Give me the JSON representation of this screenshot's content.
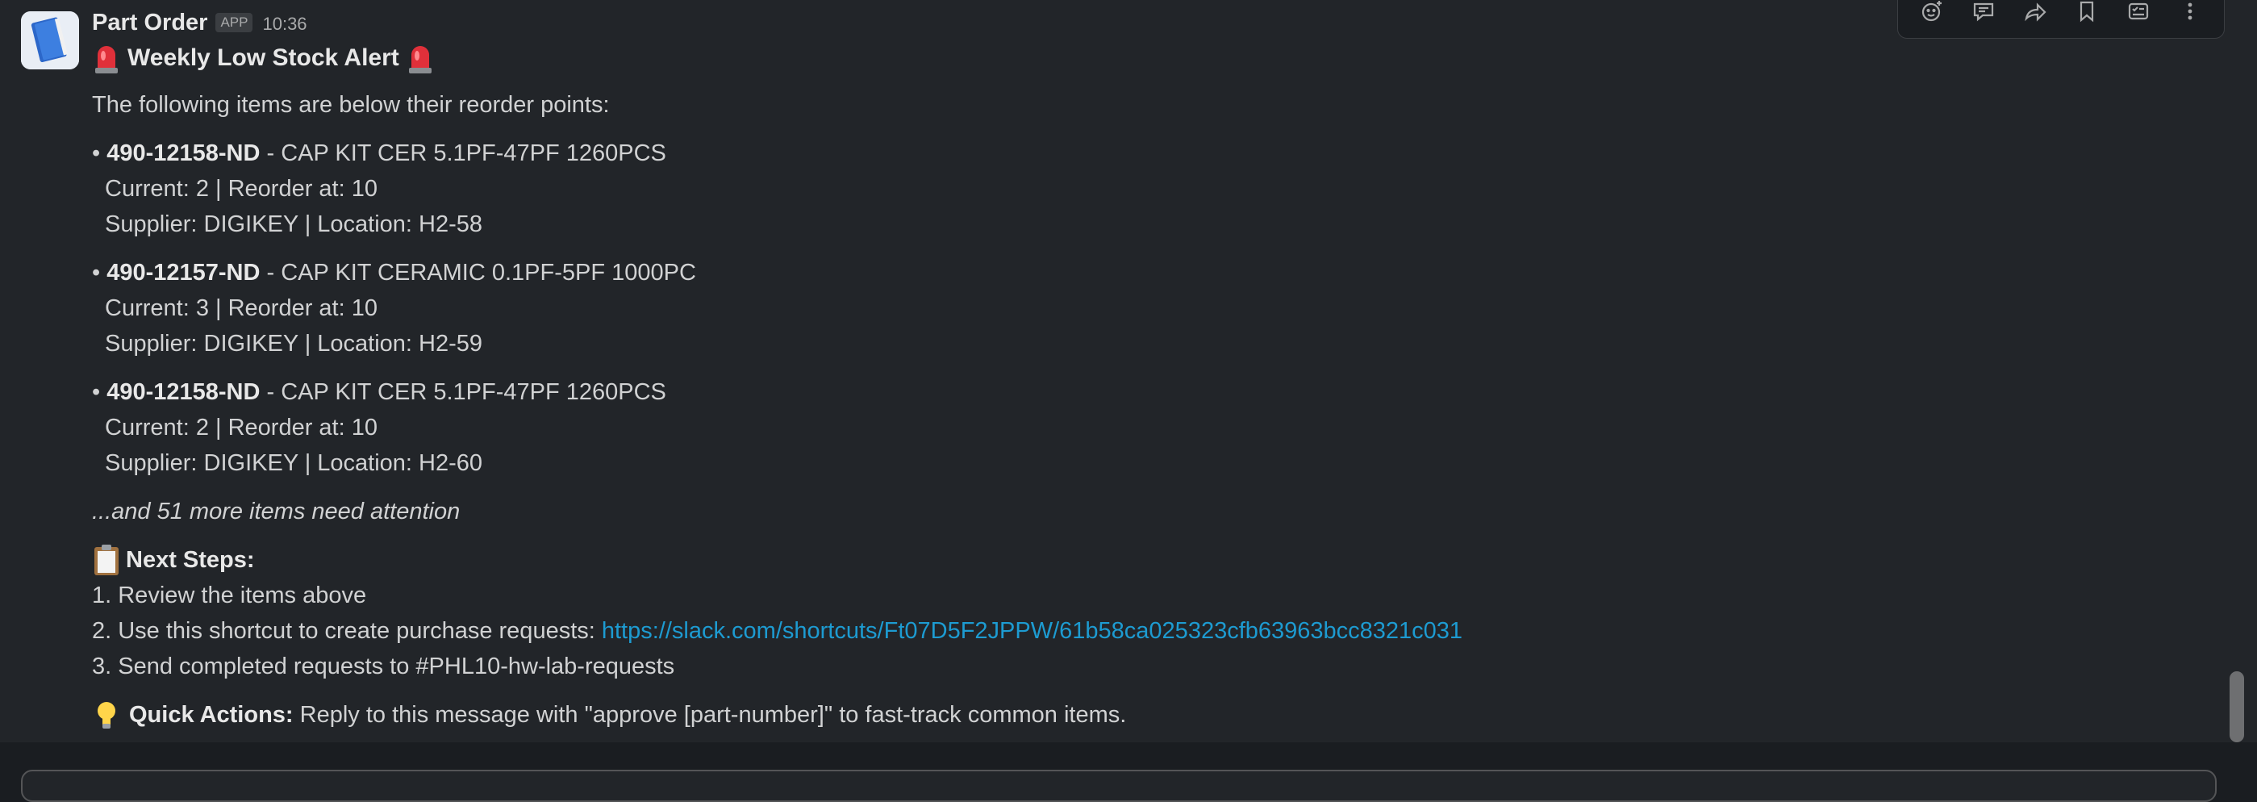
{
  "message": {
    "sender": "Part Order",
    "badge": "APP",
    "time": "10:36",
    "title": "Weekly Low Stock Alert",
    "intro": "The following items are below their reorder points:",
    "items": [
      {
        "part": "490-12158-ND",
        "desc": " - CAP KIT CER 5.1PF-47PF 1260PCS",
        "stock": "Current: 2 | Reorder at: 10",
        "supplier": "Supplier: DIGIKEY | Location: H2-58"
      },
      {
        "part": "490-12157-ND",
        "desc": " - CAP KIT CERAMIC 0.1PF-5PF 1000PC",
        "stock": "Current: 3 | Reorder at: 10",
        "supplier": "Supplier: DIGIKEY | Location: H2-59"
      },
      {
        "part": "490-12158-ND",
        "desc": " - CAP KIT CER 5.1PF-47PF 1260PCS",
        "stock": "Current: 2 | Reorder at: 10",
        "supplier": "Supplier: DIGIKEY | Location: H2-60"
      }
    ],
    "more": "...and 51 more items need attention",
    "steps_title": "Next Steps:",
    "step1": "1. Review the items above",
    "step2_prefix": "2. Use this shortcut to create purchase requests: ",
    "step2_link": "https://slack.com/shortcuts/Ft07D5F2JPPW/61b58ca025323cfb63963bcc8321c031",
    "step3": "3. Send completed requests to #PHL10-hw-lab-requests",
    "quick_label": "Quick Actions:",
    "quick_text": " Reply to this message with \"approve [part-number]\" to fast-track common items."
  },
  "toolbar": {
    "icons": [
      "emoji-reaction-icon",
      "reply-thread-icon",
      "forward-icon",
      "bookmark-icon",
      "save-for-later-icon",
      "more-options-icon"
    ]
  },
  "colors": {
    "background": "#1a1d21",
    "message_bg": "#222529",
    "text": "#d1d2d3",
    "link": "#1d9bd1"
  }
}
